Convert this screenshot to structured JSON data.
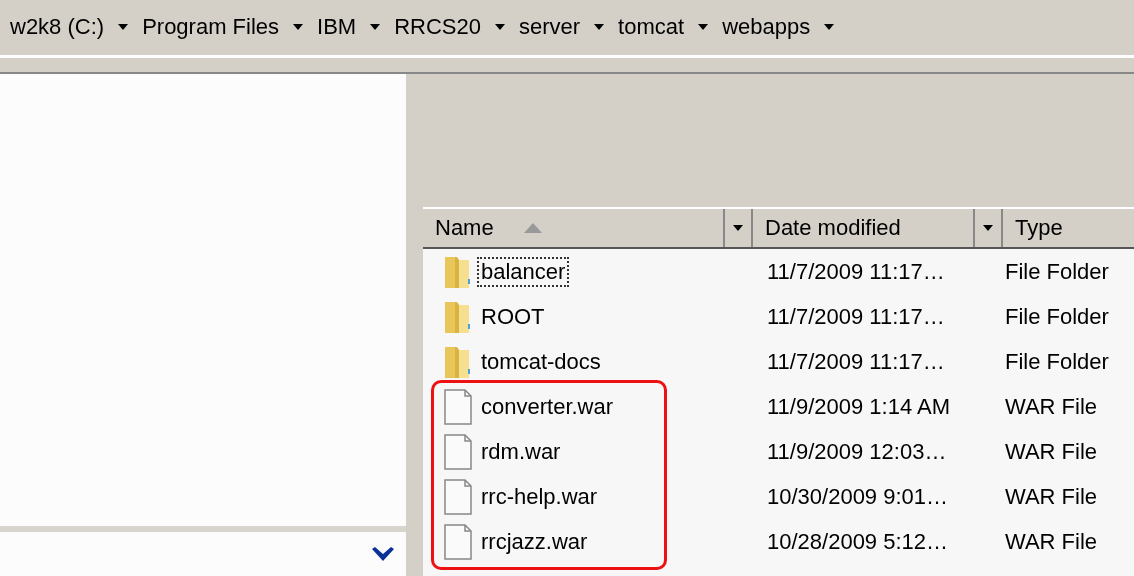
{
  "breadcrumb": [
    "w2k8 (C:)",
    "Program Files",
    "IBM",
    "RRCS20",
    "server",
    "tomcat",
    "webapps"
  ],
  "columns": [
    {
      "label": "Name",
      "sorted": true,
      "dropdown": true
    },
    {
      "label": "Date modified",
      "sorted": false,
      "dropdown": true
    },
    {
      "label": "Type",
      "sorted": false,
      "dropdown": false
    }
  ],
  "rows": [
    {
      "kind": "folder",
      "name": "balancer",
      "date": "11/7/2009 11:17…",
      "type": "File Folder",
      "focused": true,
      "highlighted": false
    },
    {
      "kind": "folder",
      "name": "ROOT",
      "date": "11/7/2009 11:17…",
      "type": "File Folder",
      "focused": false,
      "highlighted": false
    },
    {
      "kind": "folder",
      "name": "tomcat-docs",
      "date": "11/7/2009 11:17…",
      "type": "File Folder",
      "focused": false,
      "highlighted": false
    },
    {
      "kind": "file",
      "name": "converter.war",
      "date": "11/9/2009 1:14 AM",
      "type": "WAR File",
      "focused": false,
      "highlighted": true
    },
    {
      "kind": "file",
      "name": "rdm.war",
      "date": "11/9/2009 12:03…",
      "type": "WAR File",
      "focused": false,
      "highlighted": true
    },
    {
      "kind": "file",
      "name": "rrc-help.war",
      "date": "10/30/2009 9:01…",
      "type": "WAR File",
      "focused": false,
      "highlighted": true
    },
    {
      "kind": "file",
      "name": "rrcjazz.war",
      "date": "10/28/2009 5:12…",
      "type": "WAR File",
      "focused": false,
      "highlighted": true
    }
  ]
}
